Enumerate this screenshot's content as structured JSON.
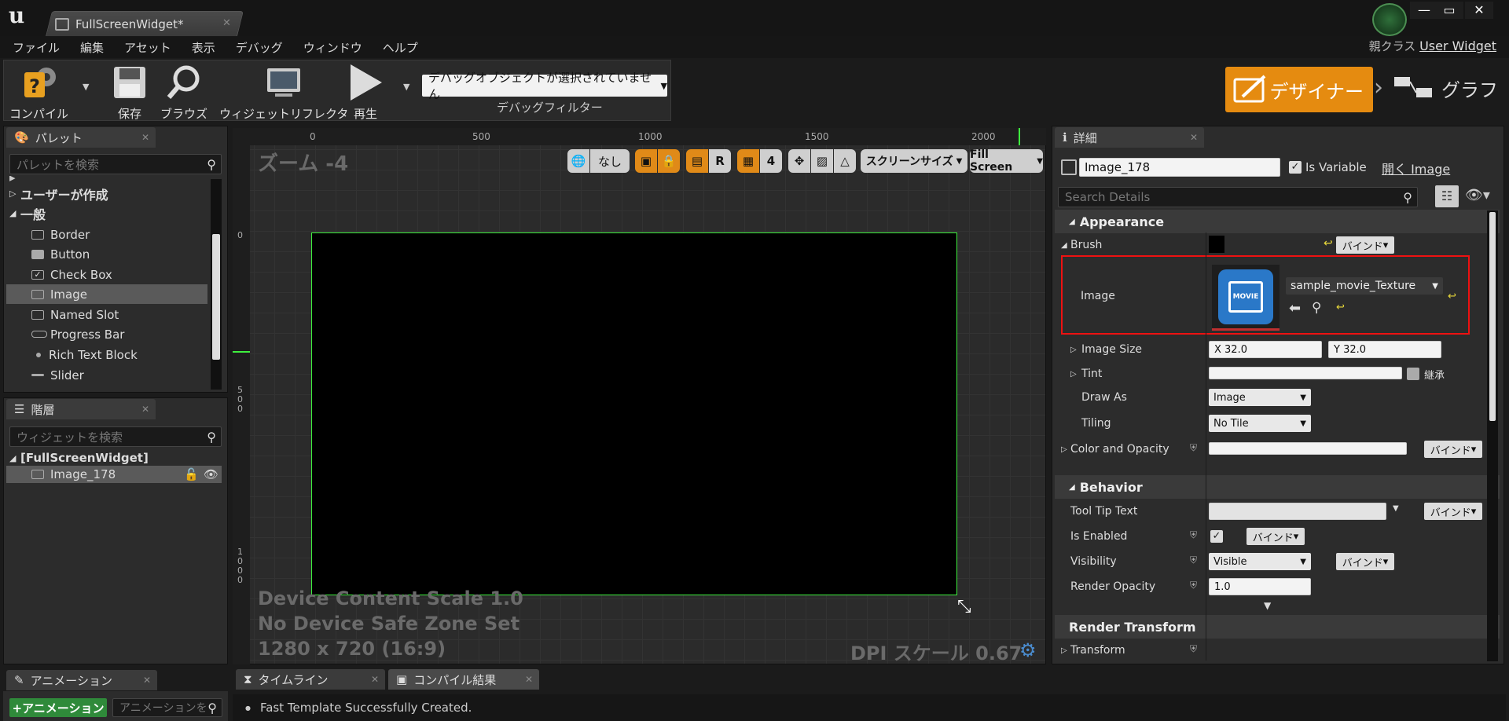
{
  "window": {
    "tab_title": "FullScreenWidget*",
    "minimize": "—",
    "maximize": "▭",
    "close": "✕"
  },
  "menu": [
    "ファイル",
    "編集",
    "アセット",
    "表示",
    "デバッグ",
    "ウィンドウ",
    "ヘルプ"
  ],
  "parent_class": {
    "label": "親クラス",
    "value": "User Widget"
  },
  "toolbar": {
    "compile": "コンパイル",
    "save": "保存",
    "browse": "ブラウズ",
    "widget_reflector": "ウィジェットリフレクタ",
    "play": "再生",
    "debug_object": "デバッグオブジェクトが選択されていません",
    "debug_filter": "デバッグフィルター"
  },
  "modes": {
    "designer": "デザイナー",
    "graph": "グラフ"
  },
  "palette": {
    "tab": "パレット",
    "search_placeholder": "パレットを検索",
    "category_user": "ユーザーが作成",
    "category_general": "一般",
    "items": [
      "Border",
      "Button",
      "Check Box",
      "Image",
      "Named Slot",
      "Progress Bar",
      "Rich Text Block",
      "Slider"
    ]
  },
  "hierarchy": {
    "tab": "階層",
    "search_placeholder": "ウィジェットを検索",
    "root": "[FullScreenWidget]",
    "child": "Image_178"
  },
  "animation": {
    "tab": "アニメーション",
    "add": "+アニメーション",
    "search_placeholder": "アニメーションを"
  },
  "designer": {
    "zoom": "ズーム -4",
    "ruler_top": [
      "0",
      "500",
      "1000",
      "1500",
      "2000"
    ],
    "ruler_left": [
      "0",
      "5\n0\n0",
      "1\n0\n0\n0"
    ],
    "localization": "なし",
    "r_button": "R",
    "grid_size": "4",
    "screen_size": "スクリーンサイズ",
    "fill_screen": "Fill Screen",
    "scale_info": "Device Content Scale 1.0",
    "safe_zone": "No Device Safe Zone Set",
    "resolution": "1280 x 720 (16:9)",
    "dpi": "DPI スケール 0.67"
  },
  "details": {
    "tab": "詳細",
    "name": "Image_178",
    "is_variable": "Is Variable",
    "open_link": "開く Image",
    "search_placeholder": "Search Details",
    "sections": {
      "appearance": "Appearance",
      "behavior": "Behavior",
      "render_transform": "Render Transform"
    },
    "brush": "Brush",
    "bind": "バインド",
    "image_label": "Image",
    "texture": "sample_movie_Texture",
    "movie": "MOVIE",
    "image_size": "Image Size",
    "size_x": "X  32.0",
    "size_y": "Y  32.0",
    "tint": "Tint",
    "inherit": "継承",
    "draw_as": "Draw As",
    "draw_as_value": "Image",
    "tiling": "Tiling",
    "tiling_value": "No Tile",
    "color_opacity": "Color and Opacity",
    "tooltip": "Tool Tip Text",
    "is_enabled": "Is Enabled",
    "visibility": "Visibility",
    "visibility_value": "Visible",
    "render_opacity": "Render Opacity",
    "render_opacity_value": "1.0",
    "transform": "Transform"
  },
  "bottom": {
    "timeline_tab": "タイムライン",
    "compile_tab": "コンパイル結果",
    "log": "Fast Template Successfully Created."
  }
}
